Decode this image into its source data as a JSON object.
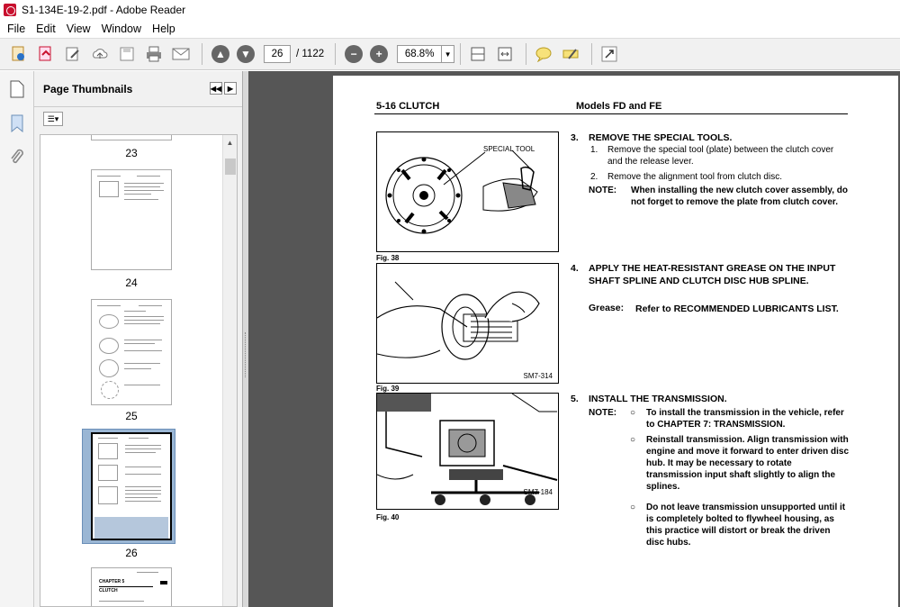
{
  "window": {
    "title": "S1-134E-19-2.pdf - Adobe Reader"
  },
  "menu": [
    "File",
    "Edit",
    "View",
    "Window",
    "Help"
  ],
  "toolbar": {
    "page_current": "26",
    "page_total": "/ 1122",
    "zoom": "68.8%"
  },
  "thumbnails": {
    "title": "Page Thumbnails",
    "pages": [
      "23",
      "24",
      "25",
      "26"
    ],
    "selected": "26",
    "next_page_text": {
      "chapter": "CHAPTER 5",
      "title": "CLUTCH"
    }
  },
  "document": {
    "header_left": "5-16 CLUTCH",
    "header_right": "Models FD and FE",
    "figures": [
      {
        "label": "Fig. 38",
        "inner_label": "SPECIAL TOOL",
        "code": ""
      },
      {
        "label": "Fig. 39",
        "inner_label": "",
        "code": "SM7-314"
      },
      {
        "label": "Fig. 40",
        "inner_label": "",
        "code": "SM7-184"
      }
    ],
    "step3": {
      "num": "3.",
      "title": "REMOVE THE SPECIAL TOOLS.",
      "item1_num": "1.",
      "item1_text": "Remove the special tool (plate) between the clutch cover and the release lever.",
      "item2_num": "2.",
      "item2_text": "Remove the alignment tool from clutch disc.",
      "note_label": "NOTE:",
      "note_text": "When installing the new clutch cover assembly, do not forget to remove the plate from clutch cover."
    },
    "step4": {
      "num": "4.",
      "title": "APPLY THE HEAT-RESISTANT GREASE ON THE INPUT SHAFT SPLINE AND CLUTCH DISC HUB SPLINE.",
      "grease_label": "Grease:",
      "grease_text": "Refer to RECOMMENDED LUBRICANTS LIST."
    },
    "step5": {
      "num": "5.",
      "title": "INSTALL THE TRANSMISSION.",
      "note_label": "NOTE:",
      "bullets": [
        "To install the transmission in the vehicle, refer to CHAPTER 7: TRANSMISSION.",
        "Reinstall transmission. Align transmission with engine and move it forward to enter driven disc hub. It may be necessary to rotate transmission input shaft slightly to align the splines.",
        "Do not leave transmission unsupported until it is completely bolted to flywheel housing, as this practice will distort or break the driven disc hubs."
      ]
    }
  }
}
